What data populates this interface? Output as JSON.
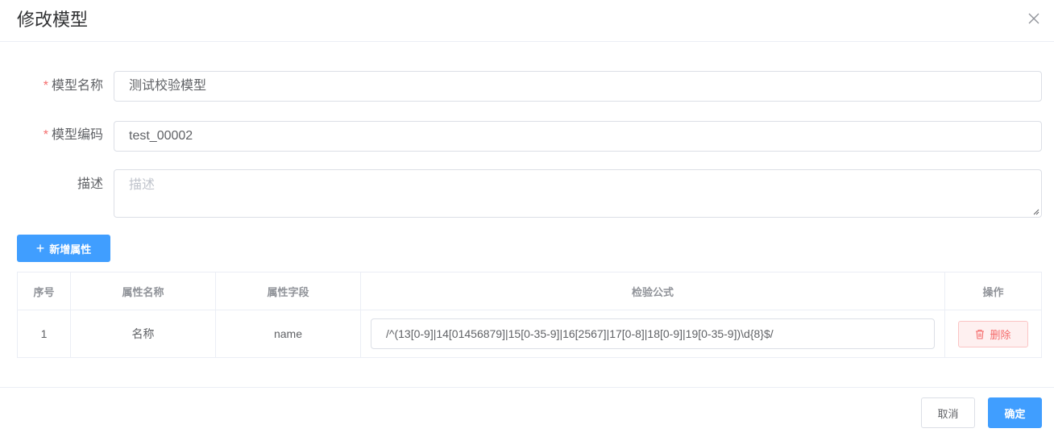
{
  "dialog": {
    "title": "修改模型",
    "close_icon": "close-icon"
  },
  "form": {
    "name": {
      "required_mark": "*",
      "label": "模型名称",
      "value": "测试校验模型"
    },
    "code": {
      "required_mark": "*",
      "label": "模型编码",
      "value": "test_00002"
    },
    "description": {
      "label": "描述",
      "placeholder": "描述",
      "value": ""
    }
  },
  "add_attribute_button": {
    "icon": "plus-icon",
    "label": "新增属性"
  },
  "table": {
    "headers": [
      "序号",
      "属性名称",
      "属性字段",
      "检验公式",
      "操作"
    ],
    "rows": [
      {
        "index": "1",
        "attr_name": "名称",
        "attr_field": "name",
        "formula": "/^(13[0-9]|14[01456879]|15[0-35-9]|16[2567]|17[0-8]|18[0-9]|19[0-35-9])\\d{8}$/",
        "delete_label": "删除",
        "delete_icon": "trash-icon"
      }
    ]
  },
  "footer": {
    "cancel_label": "取消",
    "confirm_label": "确定"
  },
  "colors": {
    "primary": "#409eff",
    "danger": "#f56c6c",
    "border": "#dcdfe6"
  }
}
